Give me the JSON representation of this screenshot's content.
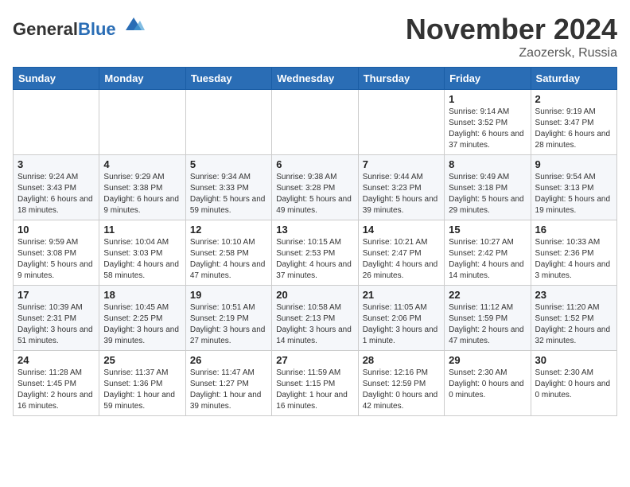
{
  "header": {
    "logo_general": "General",
    "logo_blue": "Blue",
    "month_title": "November 2024",
    "location": "Zaozersk, Russia"
  },
  "weekdays": [
    "Sunday",
    "Monday",
    "Tuesday",
    "Wednesday",
    "Thursday",
    "Friday",
    "Saturday"
  ],
  "weeks": [
    [
      {
        "day": "",
        "info": ""
      },
      {
        "day": "",
        "info": ""
      },
      {
        "day": "",
        "info": ""
      },
      {
        "day": "",
        "info": ""
      },
      {
        "day": "",
        "info": ""
      },
      {
        "day": "1",
        "info": "Sunrise: 9:14 AM\nSunset: 3:52 PM\nDaylight: 6 hours and 37 minutes."
      },
      {
        "day": "2",
        "info": "Sunrise: 9:19 AM\nSunset: 3:47 PM\nDaylight: 6 hours and 28 minutes."
      }
    ],
    [
      {
        "day": "3",
        "info": "Sunrise: 9:24 AM\nSunset: 3:43 PM\nDaylight: 6 hours and 18 minutes."
      },
      {
        "day": "4",
        "info": "Sunrise: 9:29 AM\nSunset: 3:38 PM\nDaylight: 6 hours and 9 minutes."
      },
      {
        "day": "5",
        "info": "Sunrise: 9:34 AM\nSunset: 3:33 PM\nDaylight: 5 hours and 59 minutes."
      },
      {
        "day": "6",
        "info": "Sunrise: 9:38 AM\nSunset: 3:28 PM\nDaylight: 5 hours and 49 minutes."
      },
      {
        "day": "7",
        "info": "Sunrise: 9:44 AM\nSunset: 3:23 PM\nDaylight: 5 hours and 39 minutes."
      },
      {
        "day": "8",
        "info": "Sunrise: 9:49 AM\nSunset: 3:18 PM\nDaylight: 5 hours and 29 minutes."
      },
      {
        "day": "9",
        "info": "Sunrise: 9:54 AM\nSunset: 3:13 PM\nDaylight: 5 hours and 19 minutes."
      }
    ],
    [
      {
        "day": "10",
        "info": "Sunrise: 9:59 AM\nSunset: 3:08 PM\nDaylight: 5 hours and 9 minutes."
      },
      {
        "day": "11",
        "info": "Sunrise: 10:04 AM\nSunset: 3:03 PM\nDaylight: 4 hours and 58 minutes."
      },
      {
        "day": "12",
        "info": "Sunrise: 10:10 AM\nSunset: 2:58 PM\nDaylight: 4 hours and 47 minutes."
      },
      {
        "day": "13",
        "info": "Sunrise: 10:15 AM\nSunset: 2:53 PM\nDaylight: 4 hours and 37 minutes."
      },
      {
        "day": "14",
        "info": "Sunrise: 10:21 AM\nSunset: 2:47 PM\nDaylight: 4 hours and 26 minutes."
      },
      {
        "day": "15",
        "info": "Sunrise: 10:27 AM\nSunset: 2:42 PM\nDaylight: 4 hours and 14 minutes."
      },
      {
        "day": "16",
        "info": "Sunrise: 10:33 AM\nSunset: 2:36 PM\nDaylight: 4 hours and 3 minutes."
      }
    ],
    [
      {
        "day": "17",
        "info": "Sunrise: 10:39 AM\nSunset: 2:31 PM\nDaylight: 3 hours and 51 minutes."
      },
      {
        "day": "18",
        "info": "Sunrise: 10:45 AM\nSunset: 2:25 PM\nDaylight: 3 hours and 39 minutes."
      },
      {
        "day": "19",
        "info": "Sunrise: 10:51 AM\nSunset: 2:19 PM\nDaylight: 3 hours and 27 minutes."
      },
      {
        "day": "20",
        "info": "Sunrise: 10:58 AM\nSunset: 2:13 PM\nDaylight: 3 hours and 14 minutes."
      },
      {
        "day": "21",
        "info": "Sunrise: 11:05 AM\nSunset: 2:06 PM\nDaylight: 3 hours and 1 minute."
      },
      {
        "day": "22",
        "info": "Sunrise: 11:12 AM\nSunset: 1:59 PM\nDaylight: 2 hours and 47 minutes."
      },
      {
        "day": "23",
        "info": "Sunrise: 11:20 AM\nSunset: 1:52 PM\nDaylight: 2 hours and 32 minutes."
      }
    ],
    [
      {
        "day": "24",
        "info": "Sunrise: 11:28 AM\nSunset: 1:45 PM\nDaylight: 2 hours and 16 minutes."
      },
      {
        "day": "25",
        "info": "Sunrise: 11:37 AM\nSunset: 1:36 PM\nDaylight: 1 hour and 59 minutes."
      },
      {
        "day": "26",
        "info": "Sunrise: 11:47 AM\nSunset: 1:27 PM\nDaylight: 1 hour and 39 minutes."
      },
      {
        "day": "27",
        "info": "Sunrise: 11:59 AM\nSunset: 1:15 PM\nDaylight: 1 hour and 16 minutes."
      },
      {
        "day": "28",
        "info": "Sunrise: 12:16 PM\nSunset: 12:59 PM\nDaylight: 0 hours and 42 minutes."
      },
      {
        "day": "29",
        "info": "Sunset: 2:30 AM\nDaylight: 0 hours and 0 minutes."
      },
      {
        "day": "30",
        "info": "Sunset: 2:30 AM\nDaylight: 0 hours and 0 minutes."
      }
    ]
  ]
}
